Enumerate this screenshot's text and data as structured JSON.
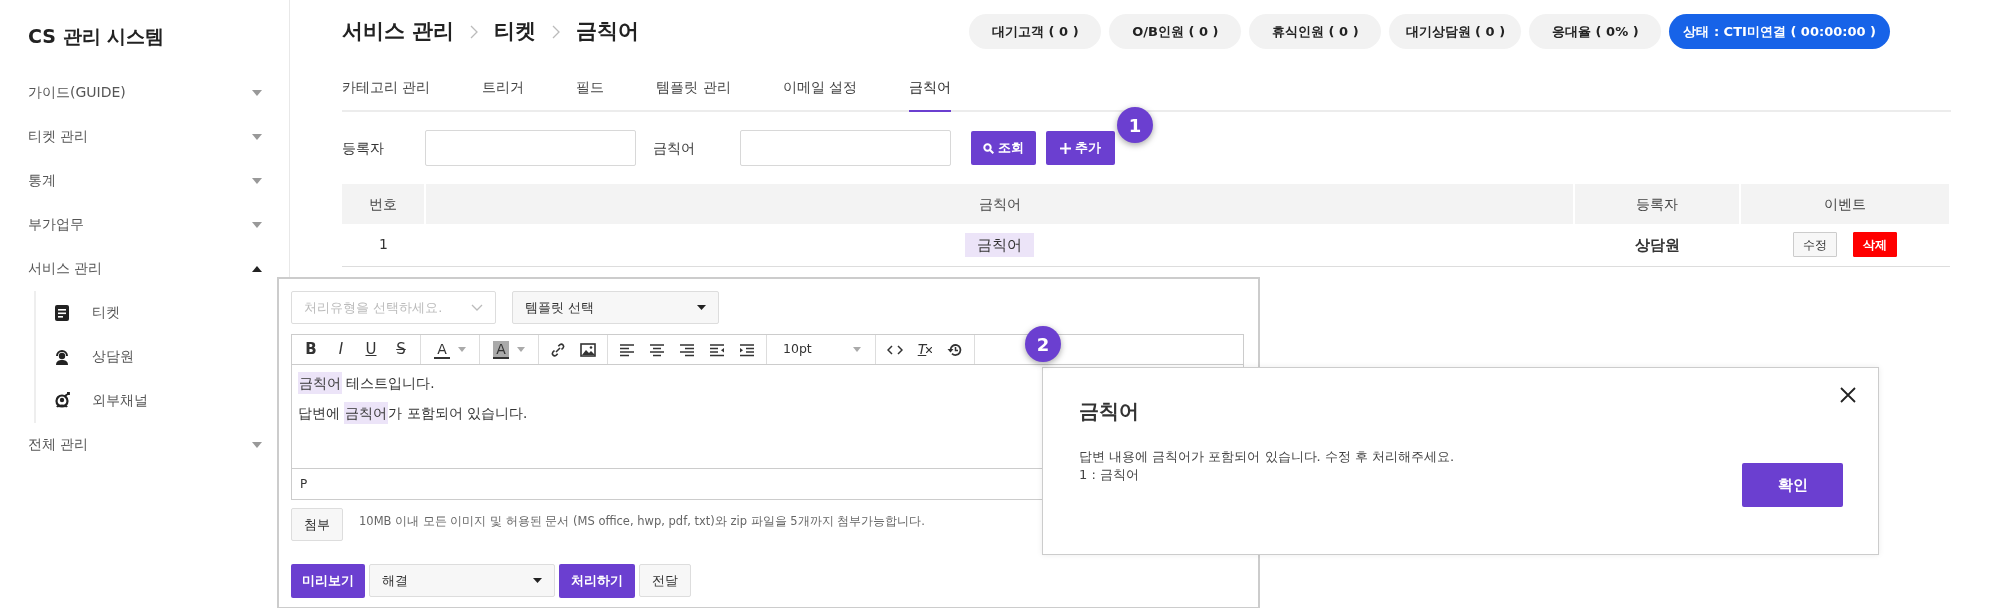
{
  "sidebar": {
    "title": "CS 관리 시스템",
    "items": [
      {
        "label": "가이드(GUIDE)",
        "expanded": false
      },
      {
        "label": "티켓 관리",
        "expanded": false
      },
      {
        "label": "통계",
        "expanded": false
      },
      {
        "label": "부가업무",
        "expanded": false
      },
      {
        "label": "서비스 관리",
        "expanded": true,
        "children": [
          {
            "label": "티켓"
          },
          {
            "label": "상담원"
          },
          {
            "label": "외부채널"
          }
        ]
      },
      {
        "label": "전체 관리",
        "expanded": false
      }
    ]
  },
  "breadcrumb": [
    "서비스 관리",
    "티켓",
    "금칙어"
  ],
  "status_pills": [
    {
      "kind": "count",
      "label": "대기고객 ( 0 )"
    },
    {
      "kind": "count",
      "label": "O/B인원 ( 0 )"
    },
    {
      "kind": "count",
      "label": "휴식인원 ( 0 )"
    },
    {
      "kind": "count",
      "label": "대기상담원 ( 0 )"
    },
    {
      "kind": "count",
      "label": "응대율 ( 0% )"
    },
    {
      "kind": "status",
      "label": "상태 : CTI미연결 ( 00:00:00 )"
    }
  ],
  "tabs": [
    {
      "label": "카테고리 관리",
      "selected": false
    },
    {
      "label": "트리거",
      "selected": false
    },
    {
      "label": "필드",
      "selected": false
    },
    {
      "label": "템플릿 관리",
      "selected": false
    },
    {
      "label": "이메일 설정",
      "selected": false
    },
    {
      "label": "금칙어",
      "selected": true
    }
  ],
  "search": {
    "fields": [
      {
        "label": "등록자"
      },
      {
        "label": "금칙어"
      }
    ],
    "search_button": "조회",
    "add_button": "추가",
    "callout": "1"
  },
  "table": {
    "columns": [
      "번호",
      "금칙어",
      "등록자",
      "이벤트"
    ],
    "rows": [
      {
        "number": "1",
        "word": "금칙어",
        "registrant": "상담원",
        "actions": [
          {
            "kind": "edit",
            "label": "수정"
          },
          {
            "kind": "delete",
            "label": "삭제"
          }
        ]
      }
    ]
  },
  "editor": {
    "type_select": {
      "placeholder": "처리유형을 선택하세요."
    },
    "template_select": "템플릿 선택",
    "toolbar": [
      [
        {
          "kind": "bold",
          "label": "B"
        },
        {
          "kind": "italic",
          "label": "I"
        },
        {
          "kind": "underline",
          "label": "U"
        },
        {
          "kind": "strike",
          "label": "S"
        }
      ],
      [
        {
          "kind": "font-color",
          "label": "A"
        }
      ],
      [
        {
          "kind": "back-color",
          "label": "A"
        }
      ],
      [
        {
          "kind": "link"
        },
        {
          "kind": "image"
        }
      ],
      [
        {
          "kind": "align-left"
        },
        {
          "kind": "align-center"
        },
        {
          "kind": "align-right"
        },
        {
          "kind": "outdent"
        },
        {
          "kind": "indent"
        }
      ],
      [
        {
          "kind": "font-size",
          "label": "10pt"
        }
      ],
      [
        {
          "kind": "code"
        },
        {
          "kind": "clear-format",
          "label": "T"
        },
        {
          "kind": "history"
        }
      ]
    ],
    "lines": [
      [
        {
          "text": "금칙어",
          "highlight": true
        },
        {
          "text": " 테스트입니다.",
          "highlight": false
        }
      ],
      [
        {
          "text": "답변에 ",
          "highlight": false
        },
        {
          "text": "금칙어",
          "highlight": true
        },
        {
          "text": "가 포함되어 있습니다.",
          "highlight": false
        }
      ]
    ],
    "path": "P",
    "attach_button": "첨부",
    "attach_note": "10MB 이내 모든 이미지 및 허용된 문서 (MS office, hwp, pdf, txt)와 zip 파일을 5개까지 첨부가능합니다.",
    "preview_button": "미리보기",
    "result_select": "해결",
    "process_button": "처리하기",
    "forward_button": "전달"
  },
  "dialog": {
    "callout": "2",
    "title": "금칙어",
    "message": [
      "답변 내용에 금칙어가 포함되어 있습니다. 수정 후 처리해주세요.",
      "1 : 금칙어"
    ],
    "confirm_button": "확인"
  }
}
